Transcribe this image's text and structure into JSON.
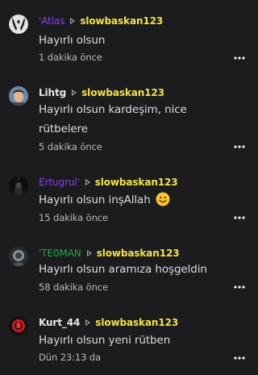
{
  "colors": {
    "background": "#1c1c1f",
    "reply_target": "#f2e24a",
    "comment_text": "#dcdce0",
    "timestamp": "#b8b8bf"
  },
  "comments": [
    {
      "author": "'Atlas",
      "author_color": "#8b3ff5",
      "reply_to": "slowbaskan123",
      "text": "Hayırlı olsun",
      "time": "1 dakika önce",
      "avatar_icon": "avatar-icon"
    },
    {
      "author": "Lihtg",
      "author_color": "#e6e6ea",
      "reply_to": "slowbaskan123",
      "text": "Hayırlı olsun kardeşim, nice rütbelere",
      "time": "5 dakika önce",
      "avatar_icon": "avatar-icon"
    },
    {
      "author": "Ertugrul'",
      "author_color": "#8b3ff5",
      "reply_to": "slowbaskan123",
      "text": "Hayırlı olsun inşAllah",
      "emoji": "smiling-face-icon",
      "time": "15 dakika önce",
      "avatar_icon": "avatar-icon"
    },
    {
      "author": "'TE0MAN",
      "author_color": "#1fa94a",
      "reply_to": "slowbaskan123",
      "text": "Hayırlı olsun aramıza hoşgeldin",
      "time": "58 dakika önce",
      "avatar_icon": "avatar-icon"
    },
    {
      "author": "Kurt_44",
      "author_color": "#e6e6ea",
      "reply_to": "slowbaskan123",
      "text": "Hayırlı olsun yeni rütben",
      "time": "Dün 23:13 da",
      "avatar_icon": "avatar-icon"
    }
  ]
}
